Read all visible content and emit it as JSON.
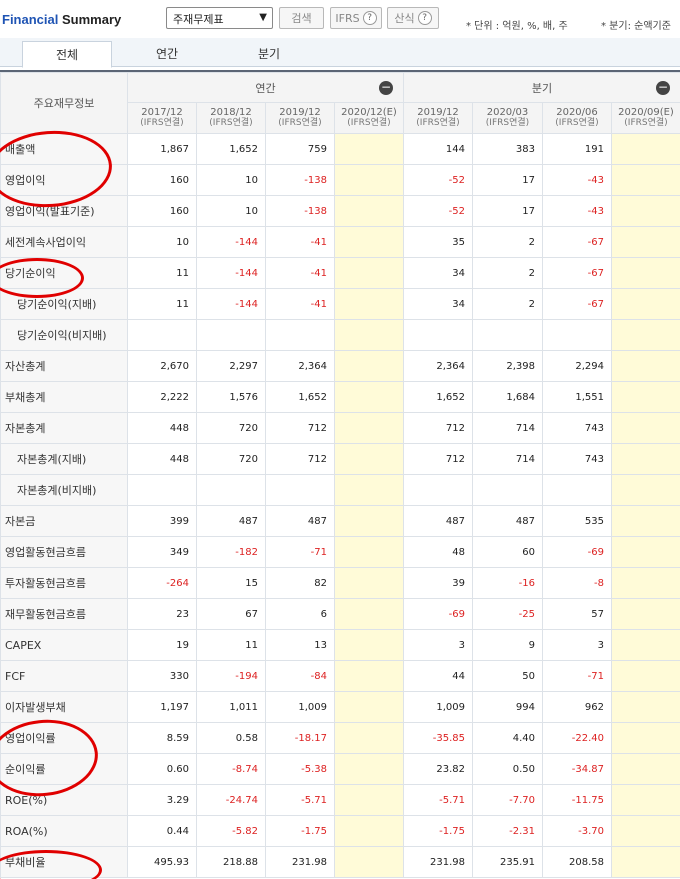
{
  "header": {
    "title_part1": "Financial",
    "title_part2": "Summary",
    "select_value": "주재무제표",
    "search_label": "검색",
    "ifrs_label": "IFRS",
    "formula_label": "산식",
    "unit_text": "* 단위 : 억원, %, 배, 주",
    "period_text": "* 분기: 순액기준"
  },
  "tabs": [
    {
      "label": "전체"
    },
    {
      "label": "연간"
    },
    {
      "label": "분기"
    }
  ],
  "table": {
    "row_header": "주요재무정보",
    "group_annual": "연간",
    "group_quarter": "분기",
    "columns": [
      {
        "period": "2017/12",
        "basis": "(IFRS연결)"
      },
      {
        "period": "2018/12",
        "basis": "(IFRS연결)"
      },
      {
        "period": "2019/12",
        "basis": "(IFRS연결)"
      },
      {
        "period": "2020/12(E)",
        "basis": "(IFRS연결)"
      },
      {
        "period": "2019/12",
        "basis": "(IFRS연결)"
      },
      {
        "period": "2020/03",
        "basis": "(IFRS연결)"
      },
      {
        "period": "2020/06",
        "basis": "(IFRS연결)"
      },
      {
        "period": "2020/09(E)",
        "basis": "(IFRS연결)"
      }
    ],
    "rows": [
      {
        "label": "매출액",
        "indent": false,
        "values": [
          "1,867",
          "1,652",
          "759",
          "",
          "144",
          "383",
          "191",
          ""
        ]
      },
      {
        "label": "영업이익",
        "indent": false,
        "values": [
          "160",
          "10",
          "-138",
          "",
          "-52",
          "17",
          "-43",
          ""
        ]
      },
      {
        "label": "영업이익(발표기준)",
        "indent": false,
        "values": [
          "160",
          "10",
          "-138",
          "",
          "-52",
          "17",
          "-43",
          ""
        ]
      },
      {
        "label": "세전계속사업이익",
        "indent": false,
        "values": [
          "10",
          "-144",
          "-41",
          "",
          "35",
          "2",
          "-67",
          ""
        ]
      },
      {
        "label": "당기순이익",
        "indent": false,
        "values": [
          "11",
          "-144",
          "-41",
          "",
          "34",
          "2",
          "-67",
          ""
        ]
      },
      {
        "label": "당기순이익(지배)",
        "indent": true,
        "values": [
          "11",
          "-144",
          "-41",
          "",
          "34",
          "2",
          "-67",
          ""
        ]
      },
      {
        "label": "당기순이익(비지배)",
        "indent": true,
        "values": [
          "",
          "",
          "",
          "",
          "",
          "",
          "",
          ""
        ]
      },
      {
        "label": "자산총계",
        "indent": false,
        "values": [
          "2,670",
          "2,297",
          "2,364",
          "",
          "2,364",
          "2,398",
          "2,294",
          ""
        ]
      },
      {
        "label": "부채총계",
        "indent": false,
        "values": [
          "2,222",
          "1,576",
          "1,652",
          "",
          "1,652",
          "1,684",
          "1,551",
          ""
        ]
      },
      {
        "label": "자본총계",
        "indent": false,
        "values": [
          "448",
          "720",
          "712",
          "",
          "712",
          "714",
          "743",
          ""
        ]
      },
      {
        "label": "자본총계(지배)",
        "indent": true,
        "values": [
          "448",
          "720",
          "712",
          "",
          "712",
          "714",
          "743",
          ""
        ]
      },
      {
        "label": "자본총계(비지배)",
        "indent": true,
        "values": [
          "",
          "",
          "",
          "",
          "",
          "",
          "",
          ""
        ]
      },
      {
        "label": "자본금",
        "indent": false,
        "values": [
          "399",
          "487",
          "487",
          "",
          "487",
          "487",
          "535",
          ""
        ]
      },
      {
        "label": "영업활동현금흐름",
        "indent": false,
        "values": [
          "349",
          "-182",
          "-71",
          "",
          "48",
          "60",
          "-69",
          ""
        ]
      },
      {
        "label": "투자활동현금흐름",
        "indent": false,
        "values": [
          "-264",
          "15",
          "82",
          "",
          "39",
          "-16",
          "-8",
          ""
        ]
      },
      {
        "label": "재무활동현금흐름",
        "indent": false,
        "values": [
          "23",
          "67",
          "6",
          "",
          "-69",
          "-25",
          "57",
          ""
        ]
      },
      {
        "label": "CAPEX",
        "indent": false,
        "values": [
          "19",
          "11",
          "13",
          "",
          "3",
          "9",
          "3",
          ""
        ]
      },
      {
        "label": "FCF",
        "indent": false,
        "values": [
          "330",
          "-194",
          "-84",
          "",
          "44",
          "50",
          "-71",
          ""
        ]
      },
      {
        "label": "이자발생부채",
        "indent": false,
        "values": [
          "1,197",
          "1,011",
          "1,009",
          "",
          "1,009",
          "994",
          "962",
          ""
        ]
      },
      {
        "label": "영업이익률",
        "indent": false,
        "values": [
          "8.59",
          "0.58",
          "-18.17",
          "",
          "-35.85",
          "4.40",
          "-22.40",
          ""
        ]
      },
      {
        "label": "순이익률",
        "indent": false,
        "values": [
          "0.60",
          "-8.74",
          "-5.38",
          "",
          "23.82",
          "0.50",
          "-34.87",
          ""
        ]
      },
      {
        "label": "ROE(%)",
        "indent": false,
        "values": [
          "3.29",
          "-24.74",
          "-5.71",
          "",
          "-5.71",
          "-7.70",
          "-11.75",
          ""
        ]
      },
      {
        "label": "ROA(%)",
        "indent": false,
        "values": [
          "0.44",
          "-5.82",
          "-1.75",
          "",
          "-1.75",
          "-2.31",
          "-3.70",
          ""
        ]
      },
      {
        "label": "부채비율",
        "indent": false,
        "values": [
          "495.93",
          "218.88",
          "231.98",
          "",
          "231.98",
          "235.91",
          "208.58",
          ""
        ]
      }
    ]
  },
  "colors": {
    "negative": "#dd2222",
    "estimate_bg": "#fffbd8",
    "annotation_red": "#e00000"
  }
}
